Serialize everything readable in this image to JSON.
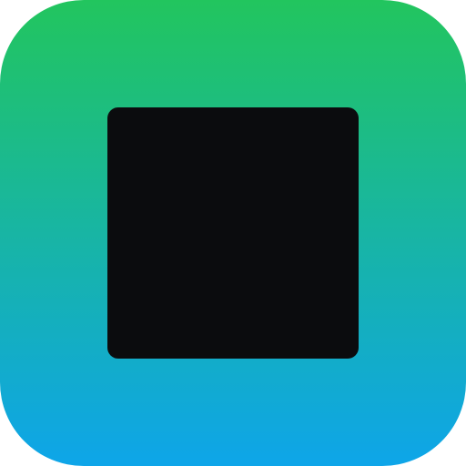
{
  "icon": {
    "name": "stop-icon",
    "colors": {
      "gradient_top": "#22c55e",
      "gradient_bottom": "#0ea5e9",
      "square": "#0b0c0e"
    }
  }
}
